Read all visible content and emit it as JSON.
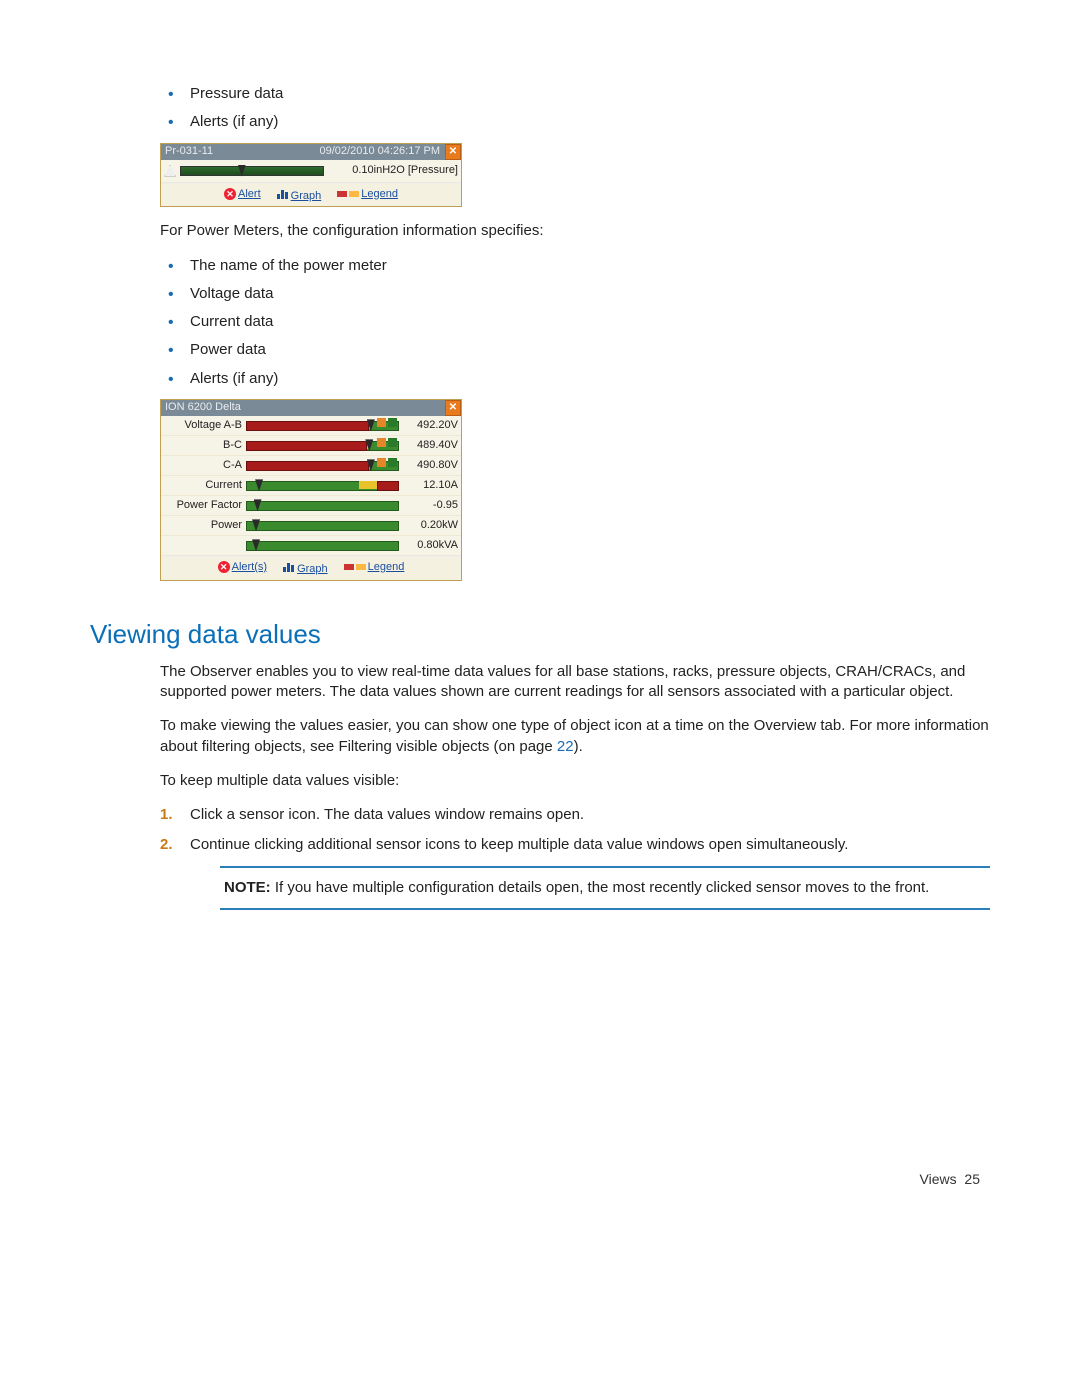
{
  "page": {
    "bullets_top": [
      "Pressure data",
      "Alerts (if any)"
    ],
    "popup1": {
      "name": "Pr-031-11",
      "datetime": "09/02/2010 04:26:17 PM",
      "value": "0.10inH2O  [Pressure]",
      "links": {
        "alert": "Alert",
        "graph": "Graph",
        "legend": "Legend"
      }
    },
    "para1": "For Power Meters, the configuration information specifies:",
    "bullets_pm": [
      "The name of the power meter",
      "Voltage data",
      "Current data",
      "Power data",
      "Alerts (if any)"
    ],
    "popup2": {
      "title": "ION 6200 Delta",
      "rows": [
        {
          "label": "Voltage A-B",
          "value": "492.20V",
          "fill_pct": 80,
          "yellow_start": 78,
          "yellow_w": 5,
          "flags": [
            "o",
            "g"
          ],
          "tri_pct": 80
        },
        {
          "label": "B-C",
          "value": "489.40V",
          "fill_pct": 79,
          "yellow_start": 77,
          "yellow_w": 5,
          "flags": [
            "o",
            "g"
          ],
          "tri_pct": 79
        },
        {
          "label": "C-A",
          "value": "490.80V",
          "fill_pct": 80,
          "yellow_start": 78,
          "yellow_w": 5,
          "flags": [
            "o",
            "g"
          ],
          "tri_pct": 80
        },
        {
          "label": "Current",
          "value": "12.10A",
          "fill_pct": 0,
          "green_only": true,
          "yellow_start": 75,
          "yellow_w": 12,
          "red_tail": true,
          "tri_pct": 6
        },
        {
          "label": "Power Factor",
          "value": "-0.95",
          "fill_pct": 0,
          "green_only": true,
          "yellow_start": 0,
          "yellow_w": 0,
          "tri_pct": 5
        },
        {
          "label": "Power",
          "value": "0.20kW",
          "fill_pct": 0,
          "green_only": true,
          "yellow_start": 0,
          "yellow_w": 0,
          "tri_pct": 4
        },
        {
          "label": "",
          "value": "0.80kVA",
          "fill_pct": 0,
          "green_only": true,
          "yellow_start": 0,
          "yellow_w": 0,
          "tri_pct": 4
        }
      ],
      "links": {
        "alert": "Alert(s)",
        "graph": "Graph",
        "legend": "Legend"
      }
    },
    "heading": "Viewing data values",
    "para2": "The Observer enables you to view real-time data values for all base stations, racks, pressure objects, CRAH/CRACs, and supported power meters. The data values shown are current readings for all sensors associated with a particular object.",
    "para3a": "To make viewing the values easier, you can show one type of object icon at a time on the Overview tab. For more information about filtering objects, see Filtering visible objects (on page ",
    "para3_link": "22",
    "para3b": ").",
    "para4": "To keep multiple data values visible:",
    "steps": [
      "Click a sensor icon. The data values window remains open.",
      "Continue clicking additional sensor icons to keep multiple data value windows open simultaneously."
    ],
    "note_label": "NOTE:",
    "note_text": "  If you have multiple configuration details open, the most recently clicked sensor moves to the front.",
    "footer_section": "Views",
    "footer_page": "25"
  }
}
